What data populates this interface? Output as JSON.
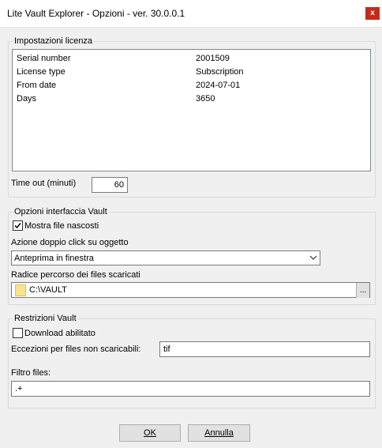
{
  "window": {
    "title": "Lite Vault Explorer - Opzioni - ver. 30.0.0.1",
    "close_glyph": "x"
  },
  "license": {
    "group_label": "Impostazioni licenza",
    "rows": [
      {
        "label": "Serial number",
        "value": "2001509"
      },
      {
        "label": "License type",
        "value": "Subscription"
      },
      {
        "label": "From date",
        "value": "2024-07-01"
      },
      {
        "label": "Days",
        "value": "3650"
      }
    ],
    "timeout_label": "Time out (minuti)",
    "timeout_value": "60"
  },
  "vault_ui": {
    "group_label": "Opzioni interfaccia Vault",
    "show_hidden_label": "Mostra file nascosti",
    "show_hidden_checked": true,
    "double_click_label": "Azione doppio click su oggetto",
    "double_click_value": "Anteprima in finestra",
    "download_root_label": "Radice percorso dei files scaricati",
    "download_root_value": "C:\\VAULT",
    "browse_glyph": "..."
  },
  "restrictions": {
    "group_label": "Restrizioni Vault",
    "download_enabled_label": "Download abilitato",
    "download_enabled_checked": false,
    "exceptions_label": "Eccezioni per files non scaricabili:",
    "exceptions_value": "tif",
    "filter_label": "Filtro files:",
    "filter_value": ".+"
  },
  "buttons": {
    "ok": "OK",
    "cancel": "Annulla"
  }
}
